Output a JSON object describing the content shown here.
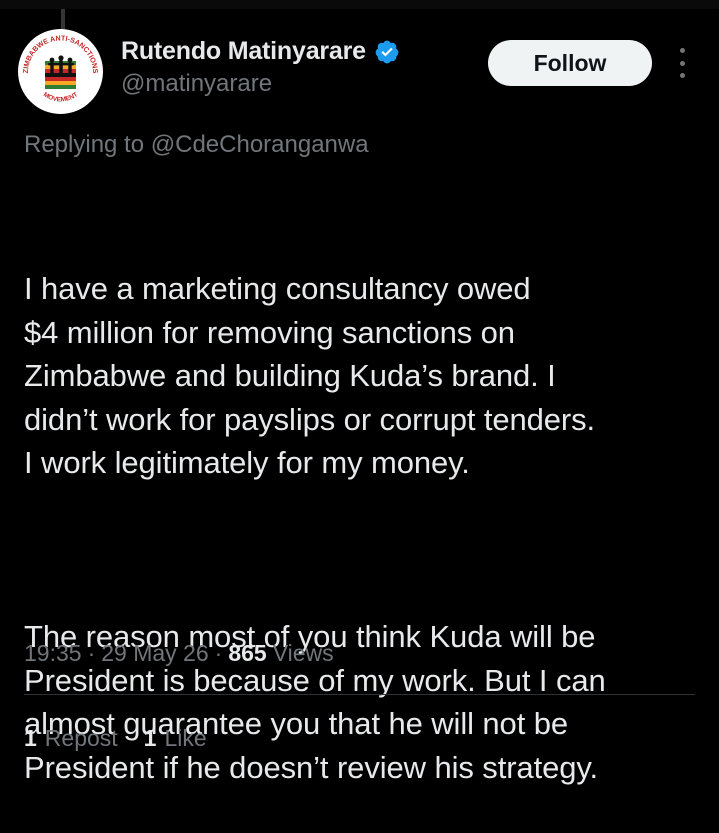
{
  "tweet": {
    "author": {
      "display_name": "Rutendo Matinyarare",
      "handle": "@matinyarare",
      "avatar_text_top": "ZIMBABWE ANTI-SANCTIONS",
      "avatar_text_bottom": "MOVEMENT"
    },
    "follow_label": "Follow",
    "reply": {
      "prefix": "Replying to",
      "mention": "@CdeChoranganwa"
    },
    "paragraphs": [
      "I have a marketing consultancy owed\n$4 million for removing sanctions on\nZimbabwe and building Kuda’s brand. I\ndidn’t work for payslips or corrupt tenders.\nI work legitimately for my money.",
      "The reason most of you think Kuda will be\nPresident is because of my work. But I can\nalmost guarantee you that he will not be\nPresident if he doesn’t review his strategy."
    ],
    "time": "19:35",
    "date": "29 May 26",
    "views_count": "865",
    "views_label": "Views",
    "separator": "·",
    "reposts_count": "1",
    "reposts_label": "Repost",
    "likes_count": "1",
    "likes_label": "Like"
  },
  "colors": {
    "background": "#000000",
    "text_primary": "#e7e9ea",
    "text_secondary": "#71767b",
    "verified_blue": "#1d9bf0",
    "follow_bg": "#eff3f4",
    "divider": "#2f3336"
  },
  "icons": {
    "verified": "verified-badge-icon",
    "more": "more-options-icon"
  }
}
